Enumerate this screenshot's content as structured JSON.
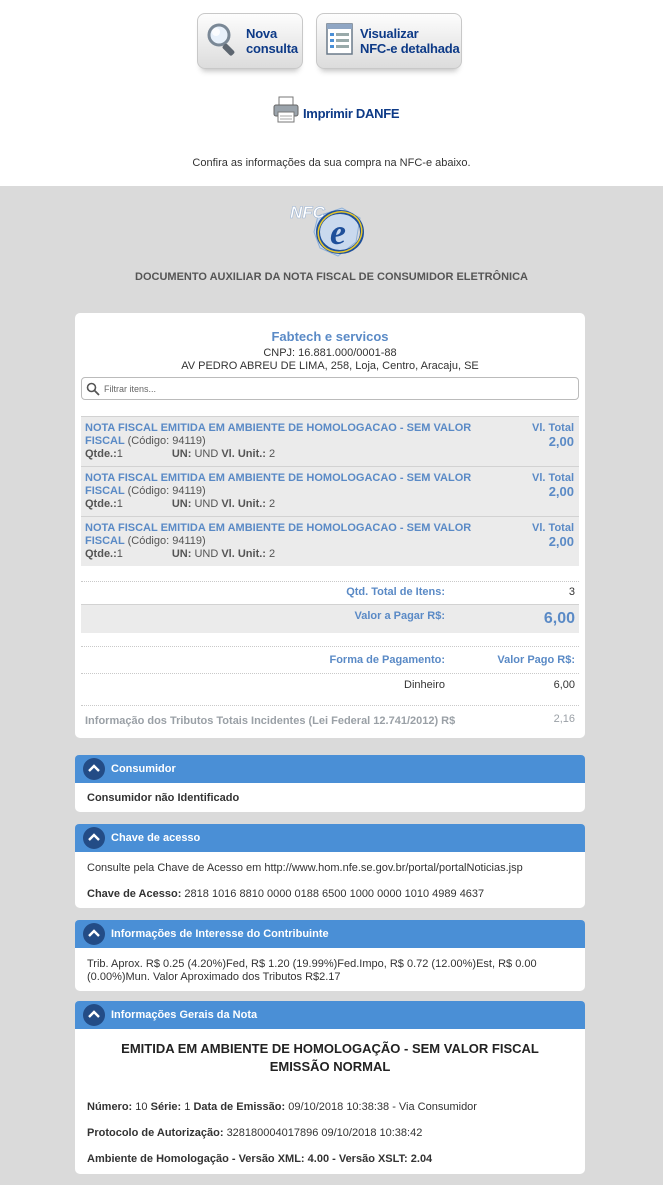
{
  "toolbar": {
    "nova_consulta": [
      "Nova",
      "consulta"
    ],
    "visualizar": [
      "Visualizar",
      "NFC-e detalhada"
    ],
    "imprimir": "Imprimir DANFE",
    "confira": "Confira as informações da sua compra na NFC-e abaixo."
  },
  "header": {
    "logo_text": "NFC-e",
    "doc_title": "DOCUMENTO AUXILIAR DA NOTA FISCAL DE CONSUMIDOR ELETRÔNICA"
  },
  "emitente": {
    "name": "Fabtech e servicos",
    "cnpj": "CNPJ: 16.881.000/0001-88",
    "address": "AV PEDRO ABREU DE LIMA, 258, Loja, Centro, Aracaju, SE"
  },
  "search": {
    "placeholder": "Filtrar itens..."
  },
  "items": [
    {
      "desc": "NOTA FISCAL EMITIDA EM AMBIENTE DE HOMOLOGACAO - SEM VALOR FISCAL",
      "code": "(Código: 94119)",
      "qtde_label": "Qtde.:",
      "qtde": "1",
      "un_label": "UN:",
      "un": "UND",
      "vunit_label": "Vl. Unit.:",
      "vunit": "2",
      "vtotal_label": "Vl. Total",
      "vtotal": "2,00"
    },
    {
      "desc": "NOTA FISCAL EMITIDA EM AMBIENTE DE HOMOLOGACAO - SEM VALOR FISCAL",
      "code": "(Código: 94119)",
      "qtde_label": "Qtde.:",
      "qtde": "1",
      "un_label": "UN:",
      "un": "UND",
      "vunit_label": "Vl. Unit.:",
      "vunit": "2",
      "vtotal_label": "Vl. Total",
      "vtotal": "2,00"
    },
    {
      "desc": "NOTA FISCAL EMITIDA EM AMBIENTE DE HOMOLOGACAO - SEM VALOR FISCAL",
      "code": "(Código: 94119)",
      "qtde_label": "Qtde.:",
      "qtde": "1",
      "un_label": "UN:",
      "un": "UND",
      "vunit_label": "Vl. Unit.:",
      "vunit": "2",
      "vtotal_label": "Vl. Total",
      "vtotal": "2,00"
    }
  ],
  "totals": {
    "qtd_label": "Qtd. Total de Itens:",
    "qtd_value": "3",
    "valor_label": "Valor a Pagar R$:",
    "valor_value": "6,00",
    "forma_label": "Forma de Pagamento:",
    "valor_pago_label": "Valor Pago R$:",
    "pagamento_tipo": "Dinheiro",
    "pagamento_valor": "6,00",
    "tributos_label": "Informação dos Tributos Totais Incidentes (Lei Federal 12.741/2012) R$",
    "tributos_value": "2,16"
  },
  "consumidor": {
    "title": "Consumidor",
    "text": "Consumidor não Identificado"
  },
  "chave": {
    "title": "Chave de acesso",
    "consulte": "Consulte pela Chave de Acesso em http://www.hom.nfe.se.gov.br/portal/portalNoticias.jsp",
    "label": "Chave de Acesso:",
    "value": "2818 1016 8810 0000 0188 6500 1000 0000 1010 4989 4637"
  },
  "contribuinte": {
    "title": "Informações de Interesse do Contribuinte",
    "line1": "Trib. Aprox. R$ 0.25 (4.20%)Fed, R$ 1.20 (19.99%)Fed.Impo, R$ 0.72 (12.00%)Est, R$ 0.00",
    "line2": "(0.00%)Mun. Valor Aproximado dos Tributos R$2.17"
  },
  "gerais": {
    "title": "Informações Gerais da Nota",
    "heading1": "EMITIDA EM AMBIENTE DE HOMOLOGAÇÃO - SEM VALOR FISCAL",
    "heading2": "EMISSÃO NORMAL",
    "numero_label": "Número:",
    "numero": "10",
    "serie_label": "Série:",
    "serie": "1",
    "emissao_label": "Data de Emissão:",
    "emissao": "09/10/2018 10:38:38 - Via Consumidor",
    "protocolo_label": "Protocolo de Autorização:",
    "protocolo": "328180004017896 09/10/2018 10:38:42",
    "ambiente": "Ambiente de Homologação - Versão XML: 4.00 - Versão XSLT: 2.04"
  },
  "icons": {
    "nova": "magnifier-icon",
    "visualizar": "document-list-icon",
    "imprimir": "printer-icon",
    "search": "search-icon",
    "section": "chevron-up-icon"
  },
  "colors": {
    "accent_text": "#5a8ac6",
    "section_header": "#4a8fd6",
    "chevron_bg": "#234c86",
    "page_gray": "#dadada",
    "button_text": "#0d3a87"
  }
}
